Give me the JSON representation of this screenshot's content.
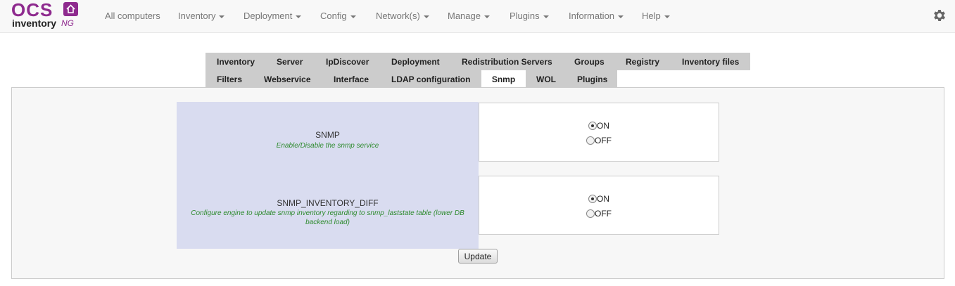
{
  "logo": {
    "top": "OCS",
    "bottom": "inventory",
    "suffix": "NG"
  },
  "nav": {
    "items": [
      {
        "label": "All computers",
        "has_menu": false
      },
      {
        "label": "Inventory",
        "has_menu": true
      },
      {
        "label": "Deployment",
        "has_menu": true
      },
      {
        "label": "Config",
        "has_menu": true
      },
      {
        "label": "Network(s)",
        "has_menu": true
      },
      {
        "label": "Manage",
        "has_menu": true
      },
      {
        "label": "Plugins",
        "has_menu": true
      },
      {
        "label": "Information",
        "has_menu": true
      },
      {
        "label": "Help",
        "has_menu": true
      }
    ],
    "settings_icon": "gear-icon"
  },
  "tabs": {
    "row1": [
      "Inventory",
      "Server",
      "IpDiscover",
      "Deployment",
      "Redistribution Servers",
      "Groups",
      "Registry",
      "Inventory files"
    ],
    "row2": [
      "Filters",
      "Webservice",
      "Interface",
      "LDAP configuration",
      "Snmp",
      "WOL",
      "Plugins"
    ],
    "active": "Snmp"
  },
  "options": [
    {
      "name": "SNMP",
      "description": "Enable/Disable the snmp service",
      "choices": [
        "ON",
        "OFF"
      ],
      "selected": "ON"
    },
    {
      "name": "SNMP_INVENTORY_DIFF",
      "description": "Configure engine to update snmp inventory regarding to snmp_laststate table (lower DB backend load)",
      "choices": [
        "ON",
        "OFF"
      ],
      "selected": "ON"
    }
  ],
  "update_label": "Update",
  "colors": {
    "brand": "#8e2a8e",
    "label_bg": "#d9dcf0",
    "description": "#2d8a2d",
    "tab_bg": "#cccccc"
  }
}
